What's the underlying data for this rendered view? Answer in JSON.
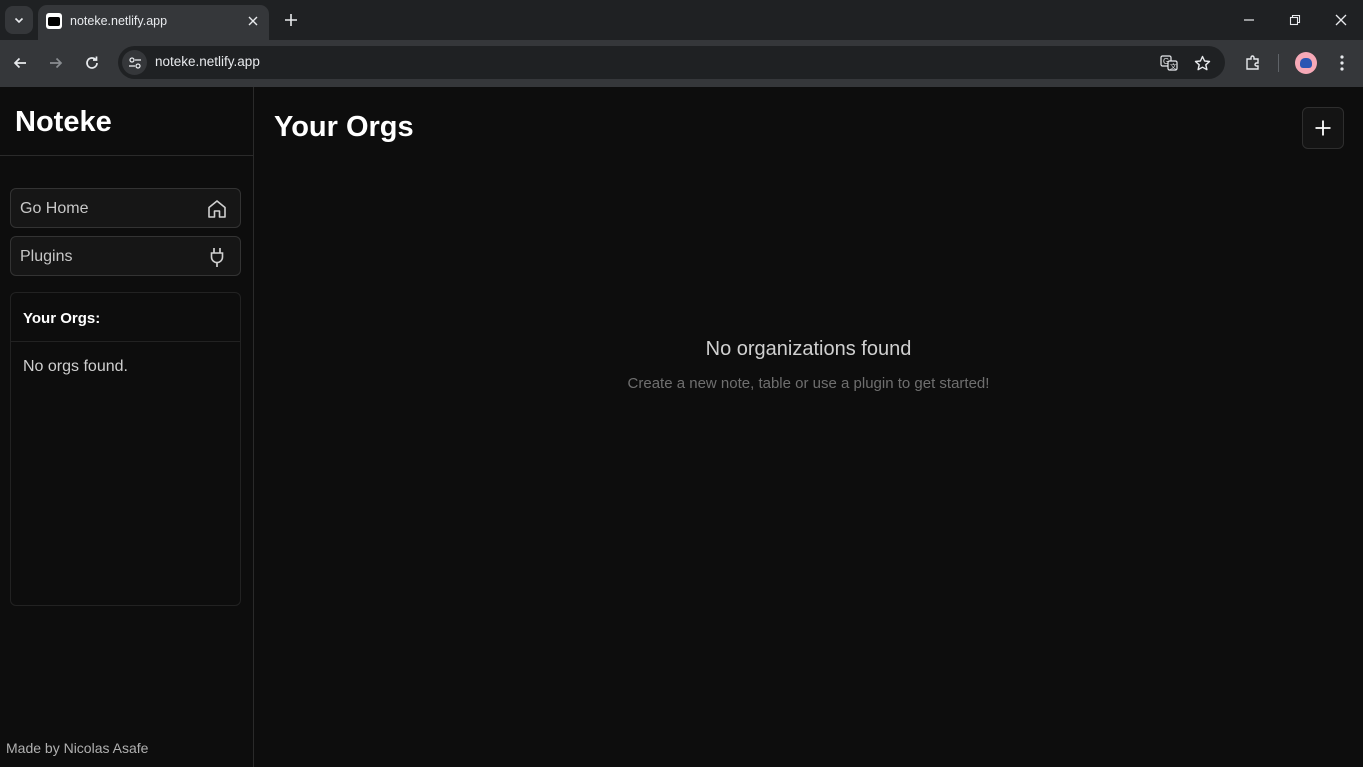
{
  "browser": {
    "tab_title": "noteke.netlify.app",
    "url": "noteke.netlify.app"
  },
  "sidebar": {
    "brand": "Noteke",
    "buttons": [
      {
        "label": "Go Home",
        "icon": "home-icon"
      },
      {
        "label": "Plugins",
        "icon": "plug-icon"
      }
    ],
    "orgs_title": "Your Orgs:",
    "orgs_empty": "No orgs found.",
    "footer": "Made by Nicolas Asafe"
  },
  "main": {
    "title": "Your Orgs",
    "add_button_icon": "plus-icon",
    "empty_title": "No organizations found",
    "empty_subtitle": "Create a new note, table or use a plugin to get started!"
  },
  "colors": {
    "background": "#0d0d0d",
    "chrome_dark": "#1f2123",
    "chrome_light": "#35373a",
    "text_primary": "#ffffff",
    "text_muted": "#6f6f6f"
  }
}
